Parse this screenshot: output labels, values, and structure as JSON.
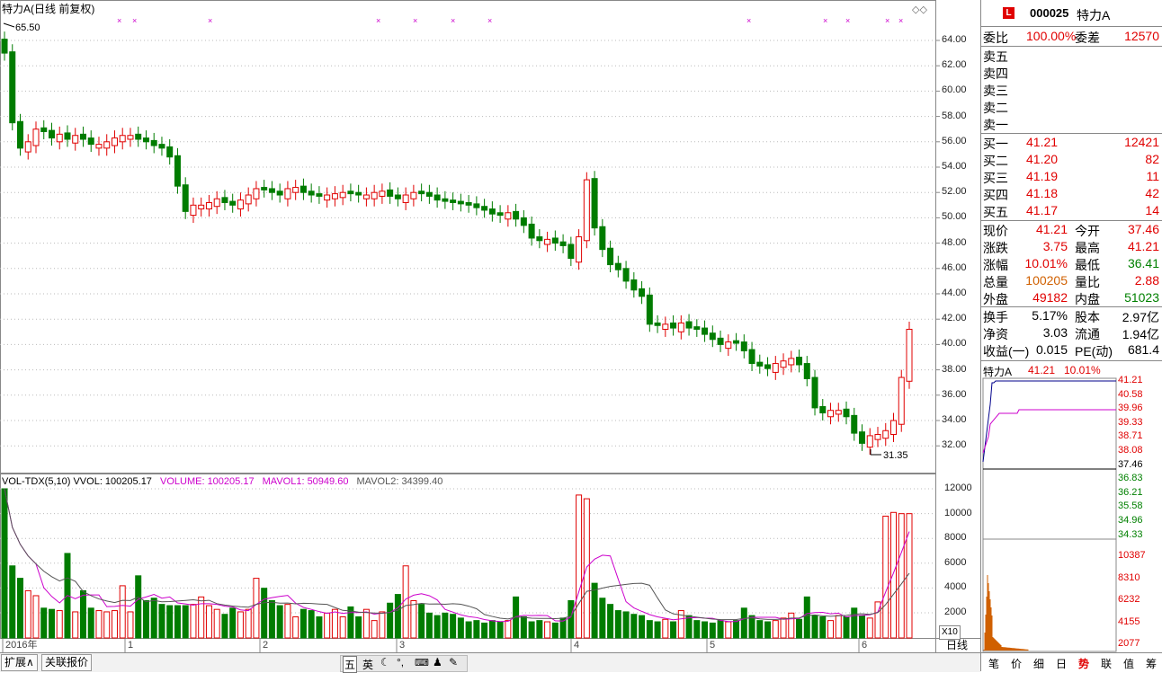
{
  "chart": {
    "title": "特力A(日线 前复权)",
    "high_marker": "65.50",
    "low_marker": "31.35",
    "y_ticks": [
      "64.00",
      "62.00",
      "60.00",
      "58.00",
      "56.00",
      "54.00",
      "52.00",
      "50.00",
      "48.00",
      "46.00",
      "44.00",
      "42.00",
      "40.00",
      "38.00",
      "36.00",
      "34.00",
      "32.00"
    ],
    "vol_ticks": [
      "12000",
      "10000",
      "8000",
      "6000",
      "4000",
      "2000"
    ],
    "vol_multiplier": "X10",
    "x_labels": [
      "2016年",
      "1",
      "2",
      "3",
      "4",
      "5",
      "6"
    ],
    "period_label": "日线",
    "vol_legend": {
      "vvol": "VOL-TDX(5,10)  VVOL: 100205.17",
      "volume": "VOLUME: 100205.17",
      "mavol1": "MAVOL1: 50949.60",
      "mavol2": "MAVOL2: 34399.40"
    },
    "colors": {
      "up": "#e00000",
      "down": "#007c00",
      "ma1": "#cc00cc",
      "ma2": "#555555",
      "marker": "#cc00cc"
    }
  },
  "quote": {
    "code": "000025",
    "name": "特力A",
    "weibi_label": "委比",
    "weibi": "100.00%",
    "weicha_label": "委差",
    "weicha": "12570",
    "sells": [
      {
        "label": "卖五",
        "price": "",
        "vol": ""
      },
      {
        "label": "卖四",
        "price": "",
        "vol": ""
      },
      {
        "label": "卖三",
        "price": "",
        "vol": ""
      },
      {
        "label": "卖二",
        "price": "",
        "vol": ""
      },
      {
        "label": "卖一",
        "price": "",
        "vol": ""
      }
    ],
    "buys": [
      {
        "label": "买一",
        "price": "41.21",
        "vol": "12421"
      },
      {
        "label": "买二",
        "price": "41.20",
        "vol": "82"
      },
      {
        "label": "买三",
        "price": "41.19",
        "vol": "11"
      },
      {
        "label": "买四",
        "price": "41.18",
        "vol": "42"
      },
      {
        "label": "买五",
        "price": "41.17",
        "vol": "14"
      }
    ],
    "stats": [
      {
        "l1": "现价",
        "v1": "41.21",
        "l2": "今开",
        "v2": "37.46"
      },
      {
        "l1": "涨跌",
        "v1": "3.75",
        "l2": "最高",
        "v2": "41.21"
      },
      {
        "l1": "涨幅",
        "v1": "10.01%",
        "l2": "最低",
        "v2": "36.41"
      },
      {
        "l1": "总量",
        "v1": "100205",
        "l2": "量比",
        "v2": "2.88"
      },
      {
        "l1": "外盘",
        "v1": "49182",
        "l2": "内盘",
        "v2": "51023"
      }
    ],
    "fin": [
      {
        "l1": "换手",
        "v1": "5.17%",
        "l2": "股本",
        "v2": "2.97亿"
      },
      {
        "l1": "净资",
        "v1": "3.03",
        "l2": "流通",
        "v2": "1.94亿"
      },
      {
        "l1": "收益(一)",
        "v1": "0.015",
        "l2": "PE(动)",
        "v2": "681.4"
      }
    ]
  },
  "intraday": {
    "name": "特力A",
    "price": "41.21",
    "pct": "10.01%",
    "price_ticks": [
      "41.21",
      "40.58",
      "39.96",
      "39.33",
      "38.71",
      "38.08",
      "37.46",
      "36.83",
      "36.21",
      "35.58",
      "34.96",
      "34.33"
    ],
    "vol_ticks": [
      "10387",
      "8310",
      "6232",
      "4155",
      "2077"
    ]
  },
  "tabs": [
    "笔",
    "价",
    "细",
    "日",
    "势",
    "联",
    "值",
    "筹"
  ],
  "bottom": {
    "expand": "扩展∧",
    "related": "关联报价",
    "ime": [
      "五",
      "英"
    ]
  }
}
